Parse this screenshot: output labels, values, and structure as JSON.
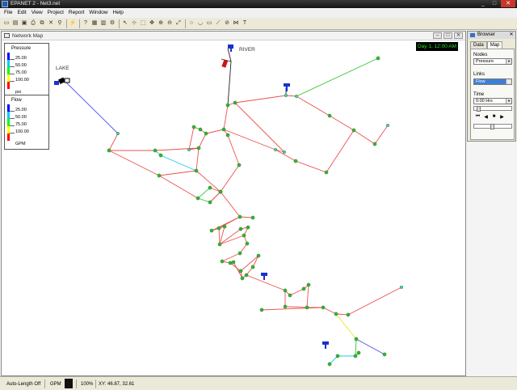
{
  "window": {
    "title": "EPANET 2 - Net3.net",
    "controls": [
      "_",
      "□",
      "✕"
    ]
  },
  "menu": [
    "File",
    "Edit",
    "View",
    "Project",
    "Report",
    "Window",
    "Help"
  ],
  "toolbar": {
    "icons": [
      "new-icon",
      "open-icon",
      "save-icon",
      "print-icon",
      "copy-icon",
      "delete-icon",
      "find-icon",
      "run-icon",
      "query-icon",
      "graph-icon",
      "table-icon",
      "options-icon",
      "select-icon",
      "vertex-icon",
      "region-icon",
      "pan-icon",
      "zoom-in-icon",
      "zoom-out-icon",
      "full-extent-icon",
      "junction-icon",
      "reservoir-icon",
      "tank-icon",
      "pipe-icon",
      "pump-icon",
      "valve-icon",
      "label-icon"
    ],
    "glyphs": [
      "▭",
      "▤",
      "▣",
      "⎙",
      "⧉",
      "✕",
      "⚲",
      "⚡",
      "?",
      "▦",
      "▥",
      "⚙",
      "↖",
      "⊹",
      "⬚",
      "✥",
      "⊕",
      "⊖",
      "⤢",
      "○",
      "◡",
      "▭",
      "⟋",
      "⊘",
      "⋈",
      "T"
    ]
  },
  "map_window": {
    "title": "Network Map",
    "clock": "Day 1, 12:00 AM",
    "labels": {
      "lake": "LAKE",
      "river": "RIVER"
    }
  },
  "legend_pressure": {
    "title": "Pressure",
    "values": [
      "25.00",
      "50.00",
      "75.00",
      "100.00"
    ],
    "unit": "psi",
    "colors": [
      "#0000ff",
      "#00c8ff",
      "#00ff00",
      "#ffff00",
      "#ff0000"
    ]
  },
  "legend_flow": {
    "title": "Flow",
    "values": [
      "25.00",
      "50.00",
      "75.00",
      "100.00"
    ],
    "unit": "GPM",
    "colors": [
      "#0000ff",
      "#00c8ff",
      "#00ff00",
      "#ffff00",
      "#ff0000"
    ]
  },
  "browser": {
    "title": "Browser",
    "tabs": [
      "Data",
      "Map"
    ],
    "nodes_label": "Nodes",
    "nodes_value": "Pressure",
    "links_label": "Links",
    "links_value": "Flow",
    "time_label": "Time",
    "time_value": "0:00 Hrs",
    "controls": [
      "⏮",
      "◀",
      "■",
      "▶"
    ]
  },
  "status": {
    "auto_length": "Auto-Length Off",
    "flow_units": "GPM",
    "zoom": "100%",
    "xy": "XY: 46.87, 32.61"
  }
}
